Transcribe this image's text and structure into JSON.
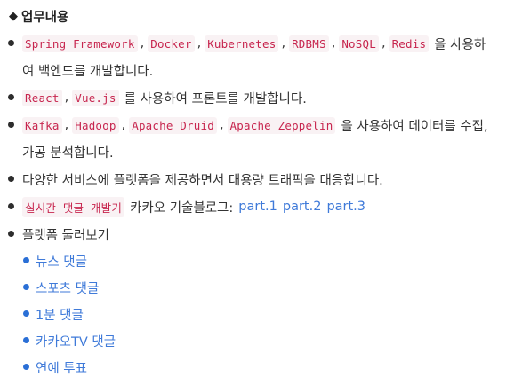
{
  "heading": {
    "marker": "◆",
    "title": "업무내용"
  },
  "items": [
    {
      "codes": [
        "Spring Framework",
        "Docker",
        "Kubernetes",
        "RDBMS",
        "NoSQL",
        "Redis"
      ],
      "suffix": "을 사용하",
      "cont": "여 백엔드를 개발합니다."
    },
    {
      "codes": [
        "React",
        "Vue.js"
      ],
      "suffix": "를 사용하여 프론트를 개발합니다."
    },
    {
      "codes": [
        "Kafka",
        "Hadoop",
        "Apache Druid",
        "Apache Zeppelin"
      ],
      "suffix": "을 사용하여 데이터를 수집,",
      "cont": "가공 분석합니다."
    },
    {
      "text": "다양한 서비스에 플랫폼을 제공하면서 대용량 트래픽을 대응합니다."
    },
    {
      "code": "실시간 댓글 개발기",
      "text": "카카오 기술블로그:",
      "links": [
        "part.1",
        "part.2",
        "part.3"
      ]
    },
    {
      "text": "플랫폼 둘러보기",
      "sublinks": [
        "뉴스 댓글",
        "스포츠 댓글",
        "1분 댓글",
        "카카오TV 댓글",
        "연예 투표"
      ]
    }
  ],
  "separator": ","
}
